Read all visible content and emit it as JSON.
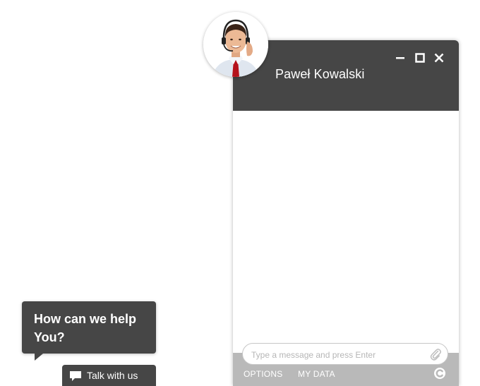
{
  "chat": {
    "agent_name": "Paweł Kowalski",
    "window_controls": {
      "minimize_icon": "minimize-icon",
      "maximize_icon": "maximize-icon",
      "close_icon": "close-icon"
    },
    "input_placeholder": "Type a message and press Enter",
    "input_value": "",
    "footer": {
      "options_label": "OPTIONS",
      "my_data_label": "MY DATA"
    }
  },
  "help_bubble": {
    "text": "How can we help You?"
  },
  "talk_button": {
    "label": "Talk with us",
    "icon": "speech-bubble-icon"
  },
  "colors": {
    "header_bg": "#464646",
    "footer_bg": "#b9b9b9",
    "tie_red": "#b5121b"
  }
}
